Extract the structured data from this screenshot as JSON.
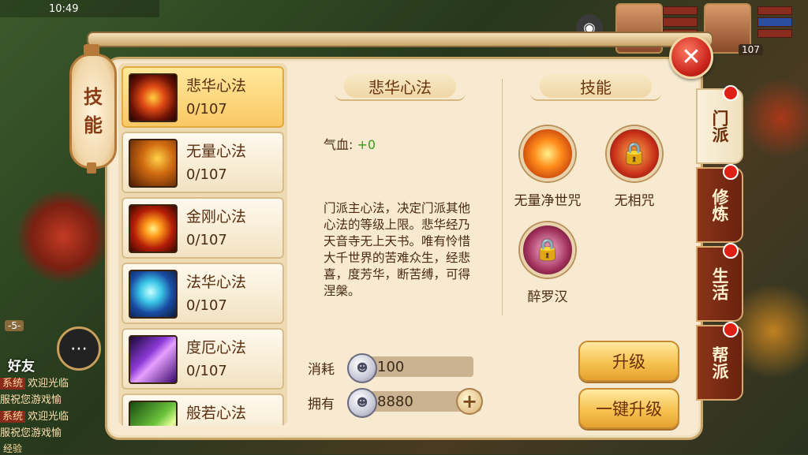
{
  "status": {
    "time": "10:49"
  },
  "hud": {
    "player_level": "107",
    "friend_label": "好友",
    "exp_label": "经验",
    "badge_level": "-5-"
  },
  "chat": [
    {
      "tag": "系统",
      "msg": "欢迎光临"
    },
    {
      "tag": "服",
      "msg": "祝您游戏愉"
    },
    {
      "tag": "系统",
      "msg": "欢迎光临"
    },
    {
      "tag": "服",
      "msg": "祝您游戏愉"
    }
  ],
  "window": {
    "tab_label": "技能",
    "close_icon": "✕"
  },
  "side_tabs": [
    {
      "label": "门派",
      "active": true
    },
    {
      "label": "修炼",
      "active": false
    },
    {
      "label": "生活",
      "active": false
    },
    {
      "label": "帮派",
      "active": false
    }
  ],
  "skill_list": [
    {
      "name": "悲华心法",
      "level": "0/107",
      "icon": "sun-wheel-icon"
    },
    {
      "name": "无量心法",
      "level": "0/107",
      "icon": "golden-palm-icon"
    },
    {
      "name": "金刚心法",
      "level": "0/107",
      "icon": "fire-wheel-icon"
    },
    {
      "name": "法华心法",
      "level": "0/107",
      "icon": "water-spirit-icon"
    },
    {
      "name": "度厄心法",
      "level": "0/107",
      "icon": "purple-light-icon"
    },
    {
      "name": "般若心法",
      "level": "",
      "icon": "green-scroll-icon"
    }
  ],
  "detail": {
    "title": "悲华心法",
    "hp_label": "气血:",
    "hp_value": "+0",
    "description": "门派主心法，决定门派其他心法的等级上限。悲华经乃天音寺无上天书。唯有怜惜大千世界的苦难众生，经悲喜，度芳华，断苦缚，可得涅槃。",
    "cost_label": "消耗",
    "cost_value": "100",
    "own_label": "拥有",
    "own_value": "8880"
  },
  "skills_panel": {
    "title": "技能",
    "skills": [
      {
        "name": "无量净世咒",
        "locked": false
      },
      {
        "name": "无相咒",
        "locked": true
      },
      {
        "name": "醉罗汉",
        "locked": true
      }
    ]
  },
  "buttons": {
    "upgrade": "升级",
    "one_key_upgrade": "一键升级"
  }
}
